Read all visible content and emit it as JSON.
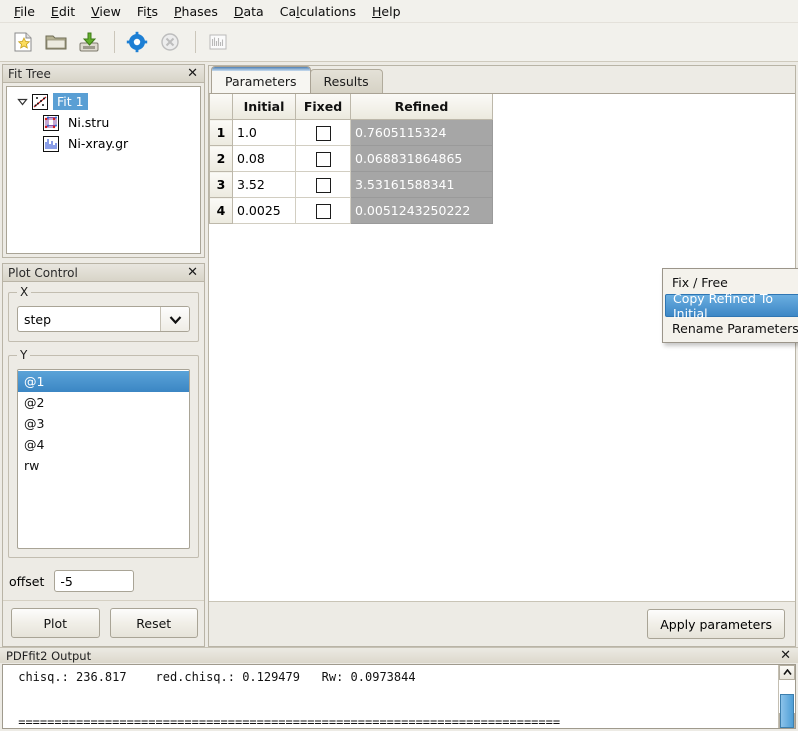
{
  "menubar": {
    "items": [
      {
        "label": "File",
        "mnemonic_index": 0
      },
      {
        "label": "Edit",
        "mnemonic_index": 0
      },
      {
        "label": "View",
        "mnemonic_index": 0
      },
      {
        "label": "Fits",
        "mnemonic_index": 2
      },
      {
        "label": "Phases",
        "mnemonic_index": 0
      },
      {
        "label": "Data",
        "mnemonic_index": 0
      },
      {
        "label": "Calculations",
        "mnemonic_index": 3
      },
      {
        "label": "Help",
        "mnemonic_index": 0
      }
    ]
  },
  "toolbar": {
    "buttons": [
      {
        "name": "new-fit-icon",
        "enabled": true
      },
      {
        "name": "open-folder-icon",
        "enabled": true
      },
      {
        "name": "save-icon",
        "enabled": true
      },
      {
        "name": "run-fit-gear-icon",
        "enabled": true
      },
      {
        "name": "stop-icon",
        "enabled": false
      },
      {
        "name": "plot-chart-icon",
        "enabled": false
      }
    ]
  },
  "fit_tree": {
    "title": "Fit Tree",
    "close_label": "✕",
    "root": {
      "label": "Fit 1",
      "selected": true,
      "expanded": true
    },
    "children": [
      {
        "label": "Ni.stru",
        "icon": "structure-icon"
      },
      {
        "label": "Ni-xray.gr",
        "icon": "dataset-icon"
      }
    ]
  },
  "plot_control": {
    "title": "Plot Control",
    "close_label": "✕",
    "x_group_label": "X",
    "x_selected": "step",
    "y_group_label": "Y",
    "y_items": [
      {
        "label": "@1",
        "selected": true
      },
      {
        "label": "@2",
        "selected": false
      },
      {
        "label": "@3",
        "selected": false
      },
      {
        "label": "@4",
        "selected": false
      },
      {
        "label": "rw",
        "selected": false
      }
    ],
    "offset_label": "offset",
    "offset_value": "-5",
    "plot_button": "Plot",
    "reset_button": "Reset"
  },
  "tabs": [
    {
      "label": "Parameters",
      "active": true
    },
    {
      "label": "Results",
      "active": false
    }
  ],
  "parameters_table": {
    "columns": [
      "",
      "Initial",
      "Fixed",
      "Refined"
    ],
    "rows": [
      {
        "index": "1",
        "initial": "1.0",
        "fixed": false,
        "refined": "0.7605115324"
      },
      {
        "index": "2",
        "initial": "0.08",
        "fixed": false,
        "refined": "0.068831864865"
      },
      {
        "index": "3",
        "initial": "3.52",
        "fixed": false,
        "refined": "3.53161588341"
      },
      {
        "index": "4",
        "initial": "0.0025",
        "fixed": false,
        "refined": "0.0051243250222"
      }
    ]
  },
  "context_menu": {
    "items": [
      {
        "label": "Fix / Free",
        "highlighted": false
      },
      {
        "label": "Copy Refined To Initial",
        "highlighted": true
      },
      {
        "label": "Rename Parameters",
        "highlighted": false
      }
    ]
  },
  "apply_button": "Apply parameters",
  "output_panel": {
    "title": "PDFfit2 Output",
    "close_label": "✕",
    "text": " chisq.: 236.817    red.chisq.: 0.129479   Rw: 0.0973844\n\n\n ==========================================================================="
  },
  "colors": {
    "selection_blue": "#5a9fd4",
    "refined_cell_gray": "#a6a6a6",
    "window_bg": "#edebe5",
    "tab_accent": "#4f81b5"
  }
}
